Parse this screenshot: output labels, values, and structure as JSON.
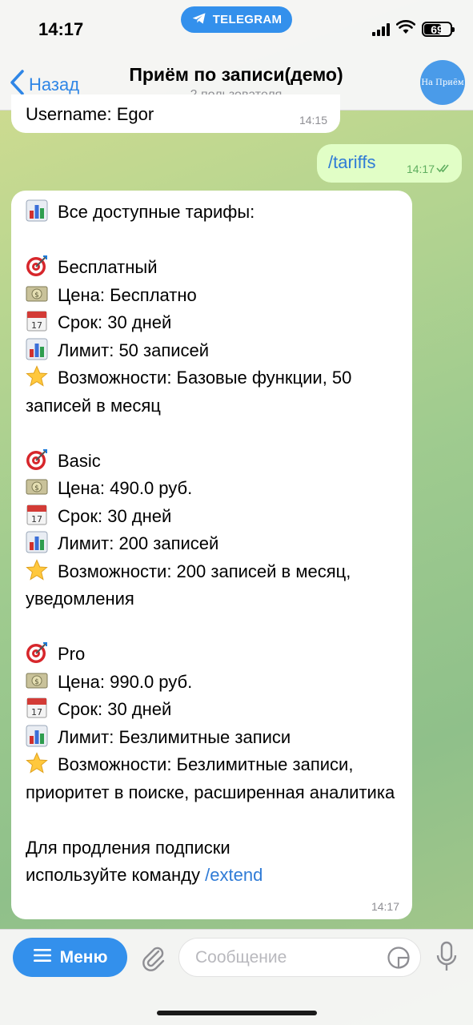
{
  "status_bar": {
    "time": "14:17",
    "telegram_label": "TELEGRAM",
    "battery_percent": "69",
    "battery_level": 0.69
  },
  "header": {
    "back_label": "Назад",
    "title": "Приём по записи(демо)",
    "subtitle": "2 пользователя",
    "avatar_text": "На Приём"
  },
  "messages": {
    "partial": {
      "text": "Username: Egor",
      "time": "14:15"
    },
    "outgoing": {
      "text": "/tariffs",
      "time": "14:17"
    },
    "incoming": {
      "time": "14:17",
      "header": "Все доступные тарифы:",
      "tariffs": [
        {
          "name": "Бесплатный",
          "price": "Цена: Бесплатно",
          "term": "Срок: 30 дней",
          "limit": "Лимит: 50 записей",
          "features": "Возможности: Базовые функции, 50 записей в месяц"
        },
        {
          "name": "Basic",
          "price": "Цена: 490.0 руб.",
          "term": "Срок: 30 дней",
          "limit": "Лимит: 200 записей",
          "features": "Возможности: 200 записей в месяц, уведомления"
        },
        {
          "name": "Pro",
          "price": "Цена: 990.0 руб.",
          "term": "Срок: 30 дней",
          "limit": "Лимит: Безлимитные записи",
          "features": "Возможности: Безлимитные записи, приоритет в поиске, расширенная аналитика"
        }
      ],
      "footer_line1": "Для продления подписки",
      "footer_line2": "используйте команду",
      "footer_command": "/extend"
    }
  },
  "input_bar": {
    "menu_label": "Меню",
    "placeholder": "Сообщение"
  },
  "icons": {
    "chart": "bar-chart-icon",
    "target": "target-icon",
    "money": "money-icon",
    "calendar": "calendar-icon",
    "star": "star-icon"
  },
  "colors": {
    "accent": "#3390ec",
    "link": "#2f7bd6",
    "outgoing_bubble": "#e1fec6"
  }
}
